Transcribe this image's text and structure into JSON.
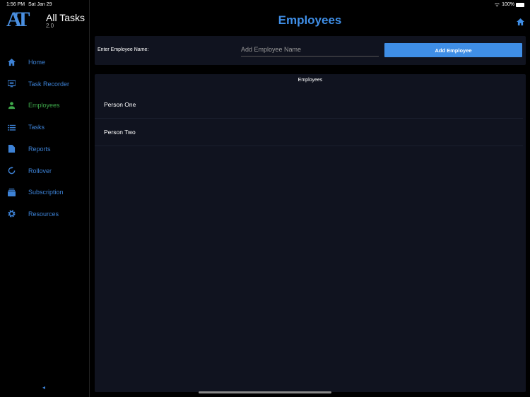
{
  "status": {
    "time": "1:56 PM",
    "date": "Sat Jan 29",
    "battery": "100%"
  },
  "app": {
    "logo": "AT",
    "title": "All Tasks",
    "version": "2.0"
  },
  "sidebar": {
    "items": [
      {
        "label": "Home",
        "icon": "home-icon"
      },
      {
        "label": "Task Recorder",
        "icon": "monitor-icon"
      },
      {
        "label": "Employees",
        "icon": "person-icon",
        "active": true
      },
      {
        "label": "Tasks",
        "icon": "list-icon"
      },
      {
        "label": "Reports",
        "icon": "document-icon"
      },
      {
        "label": "Rollover",
        "icon": "refresh-icon"
      },
      {
        "label": "Subscription",
        "icon": "subscription-icon"
      },
      {
        "label": "Resources",
        "icon": "gear-icon"
      }
    ],
    "collapse": "◂"
  },
  "header": {
    "title": "Employees"
  },
  "form": {
    "label": "Enter Employee Name:",
    "placeholder": "Add Employee Name",
    "value": "",
    "button": "Add Employee"
  },
  "list": {
    "header": "Employees",
    "rows": [
      "Person One",
      "Person Two"
    ]
  },
  "colors": {
    "accent": "#3f8ee6",
    "active": "#3ea84a",
    "panel": "#10131f"
  }
}
